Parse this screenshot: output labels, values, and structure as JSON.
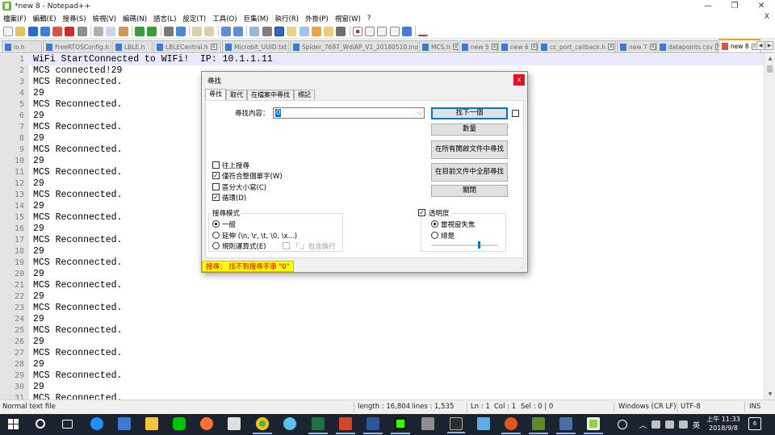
{
  "window": {
    "title": "*new 8 - Notepad++",
    "controls": {
      "minimize": "—",
      "maximize": "❐",
      "close": "✕"
    }
  },
  "menubar": {
    "items": [
      "檔案(F)",
      "編輯(E)",
      "搜尋(S)",
      "檢視(V)",
      "編碼(N)",
      "語言(L)",
      "設定(T)",
      "工具(O)",
      "巨集(M)",
      "執行(R)",
      "外掛(P)",
      "視窗(W)",
      "?"
    ],
    "close_label": "X"
  },
  "toolbar": {
    "icons": [
      "new-file-icon",
      "open-file-icon",
      "save-icon",
      "save-all-icon",
      "close-icon",
      "close-all-icon",
      "print-icon",
      "cut-icon",
      "copy-icon",
      "paste-icon",
      "undo-icon",
      "redo-icon",
      "find-icon",
      "replace-icon",
      "zoom-in-icon",
      "zoom-out-icon",
      "sync-scroll-v-icon",
      "sync-scroll-h-icon",
      "word-wrap-icon",
      "show-all-chars-icon",
      "indent-guide-icon",
      "udl-icon",
      "doc-map-icon",
      "function-list-icon",
      "folder-workspace-icon",
      "monitor-icon",
      "record-macro-icon",
      "stop-macro-icon",
      "play-macro-icon",
      "run-macro-icon",
      "save-macro-icon",
      "spellcheck-icon"
    ]
  },
  "tabs": [
    {
      "label": "io.h",
      "active": false
    },
    {
      "label": "FreeRTOSConfig.h",
      "active": false
    },
    {
      "label": "LBLE.h",
      "active": false
    },
    {
      "label": "LBLECentral.h",
      "active": false
    },
    {
      "label": "Microbit_UUID.txt",
      "active": false
    },
    {
      "label": "Spider_7697_WdiAP_V1_20180510.ino",
      "active": false
    },
    {
      "label": "MCS.h",
      "active": false
    },
    {
      "label": "new 5",
      "active": false
    },
    {
      "label": "new 6",
      "active": false
    },
    {
      "label": "cc_port_callback.h",
      "active": false
    },
    {
      "label": "new 7",
      "active": false
    },
    {
      "label": "datapoints.csv",
      "active": false
    },
    {
      "label": "new 8",
      "active": true
    }
  ],
  "editor": {
    "lines": [
      {
        "num": "1",
        "text": "WiFi StartConnected to WIFi!  IP: 10.1.1.11"
      },
      {
        "num": "2",
        "text": "MCS connected!29"
      },
      {
        "num": "3",
        "text": "MCS Reconnected."
      },
      {
        "num": "4",
        "text": "29"
      },
      {
        "num": "5",
        "text": "MCS Reconnected."
      },
      {
        "num": "6",
        "text": "29"
      },
      {
        "num": "7",
        "text": "MCS Reconnected."
      },
      {
        "num": "8",
        "text": "29"
      },
      {
        "num": "9",
        "text": "MCS Reconnected."
      },
      {
        "num": "10",
        "text": "29"
      },
      {
        "num": "11",
        "text": "MCS Reconnected."
      },
      {
        "num": "12",
        "text": "29"
      },
      {
        "num": "13",
        "text": "MCS Reconnected."
      },
      {
        "num": "14",
        "text": "29"
      },
      {
        "num": "15",
        "text": "MCS Reconnected."
      },
      {
        "num": "16",
        "text": "29"
      },
      {
        "num": "17",
        "text": "MCS Reconnected."
      },
      {
        "num": "18",
        "text": "29"
      },
      {
        "num": "19",
        "text": "MCS Reconnected."
      },
      {
        "num": "20",
        "text": "29"
      },
      {
        "num": "21",
        "text": "MCS Reconnected."
      },
      {
        "num": "22",
        "text": "29"
      },
      {
        "num": "23",
        "text": "MCS Reconnected."
      },
      {
        "num": "24",
        "text": "29"
      },
      {
        "num": "25",
        "text": "MCS Reconnected."
      },
      {
        "num": "26",
        "text": "29"
      },
      {
        "num": "27",
        "text": "MCS Reconnected."
      },
      {
        "num": "28",
        "text": "29"
      },
      {
        "num": "29",
        "text": "MCS Reconnected."
      },
      {
        "num": "30",
        "text": "29"
      },
      {
        "num": "31",
        "text": "MCS Reconnected."
      }
    ]
  },
  "statusbar": {
    "file_type": "Normal text file",
    "length": "length : 16,804",
    "lines": "lines : 1,535",
    "ln": "Ln : 1",
    "col": "Col : 1",
    "sel": "Sel : 0 | 0",
    "eol": "Windows (CR LF)",
    "encoding": "UTF-8",
    "mode": "INS"
  },
  "find_dialog": {
    "title": "尋找",
    "close": "x",
    "tabs": [
      "尋找",
      "取代",
      "在檔案中尋找",
      "標記"
    ],
    "find_label": "尋找內容：",
    "find_value": "0",
    "buttons": {
      "find_next": "找下一個",
      "count": "數量",
      "find_all_open": "在所有開啟文件中尋找",
      "find_all_current": "在目前文件中全部尋找",
      "close": "關閉"
    },
    "options": {
      "backward": "往上搜尋",
      "whole_word": "僅符合整個單字(W)",
      "match_case": "區分大小寫(C)",
      "wrap": "循環(D)"
    },
    "search_mode": {
      "title": "搜尋模式",
      "normal": "一般",
      "extended": "延伸 (\\n, \\r, \\t, \\0, \\x...)",
      "regex": "規則運算式(E)",
      "dot_newline": "「.」包含換行"
    },
    "transparency": {
      "title": "透明度",
      "on_lose_focus": "當視窗失焦",
      "always": "總是",
      "level": 0.72
    },
    "message": "搜尋： 找不到搜尋字串 \"0\""
  },
  "taskbar": {
    "ime": "英",
    "clock_time": "上午 11:33",
    "clock_date": "2018/9/8",
    "notification_count": "6"
  },
  "colors": {
    "accent": "#f7a21c",
    "current_line": "#e8e8ff",
    "message_bg": "#ffff00",
    "message_fg": "#d40000",
    "taskbar": "#1b2330"
  }
}
